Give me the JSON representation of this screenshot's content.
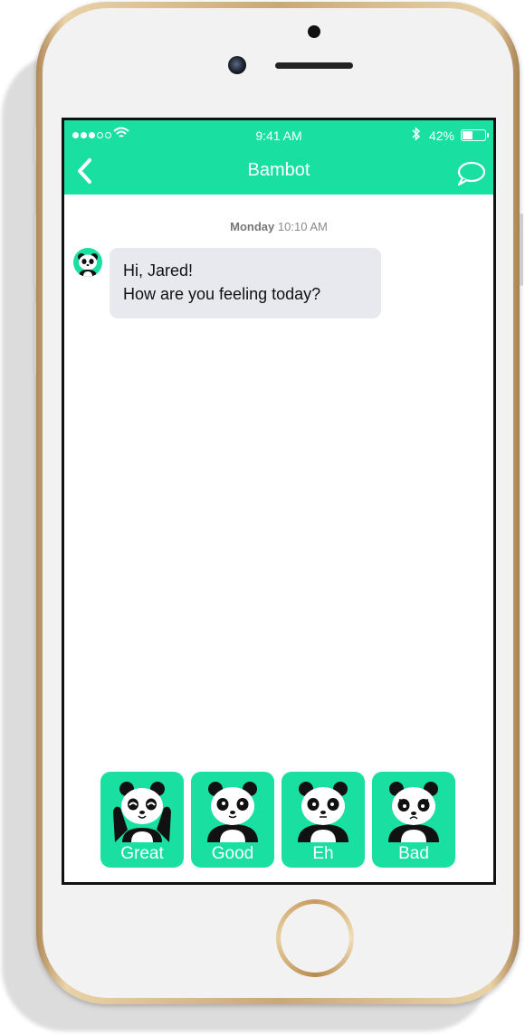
{
  "status_bar": {
    "time": "9:41 AM",
    "battery_percent": "42%",
    "signal_bars_filled": 3,
    "signal_bars_total": 5
  },
  "nav": {
    "title": "Bambot",
    "back_icon": "chevron-left-icon",
    "action_icon": "chat-bubble-icon"
  },
  "conversation": {
    "day": "Monday",
    "time": "10:10 AM",
    "messages": [
      {
        "sender": "bot",
        "lines": [
          "Hi, Jared!",
          "How are you feeling today?"
        ]
      }
    ]
  },
  "quick_replies": [
    {
      "label": "Great",
      "mood": "great"
    },
    {
      "label": "Good",
      "mood": "good"
    },
    {
      "label": "Eh",
      "mood": "eh"
    },
    {
      "label": "Bad",
      "mood": "bad"
    }
  ],
  "colors": {
    "accent": "#19e0a0",
    "bubble": "#e8e9ee",
    "phone_gold": "#c9a878"
  }
}
